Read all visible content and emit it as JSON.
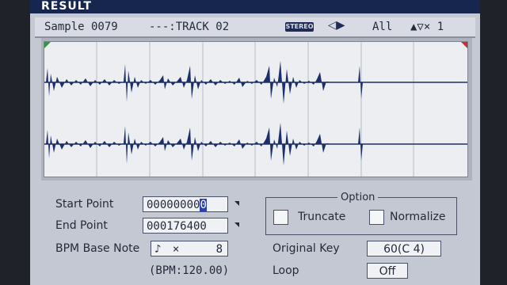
{
  "title": "RESULT",
  "info": {
    "sample": "Sample 0079",
    "track": "---:TRACK 02",
    "stereo_badge": "STEREO",
    "channel": "All",
    "zoom": "▲▽× 1"
  },
  "fields": {
    "start_label": "Start Point",
    "start_value": "00000000",
    "start_cursor": "0",
    "end_label": "End Point",
    "end_value": "000176400",
    "bpm_label": "BPM Base Note",
    "note_symbol": "♪",
    "note_mult": "×",
    "note_value": "8",
    "bpm_display": "(BPM:120.00)"
  },
  "option": {
    "title": "Option",
    "truncate": "Truncate",
    "normalize": "Normalize",
    "orig_key_label": "Original Key",
    "orig_key_value": "60(C 4)",
    "loop_label": "Loop",
    "loop_value": "Off"
  },
  "colors": {
    "wave": "#1d2f6b",
    "panel": "#c4c8d3",
    "title_bar": "#16264e"
  }
}
